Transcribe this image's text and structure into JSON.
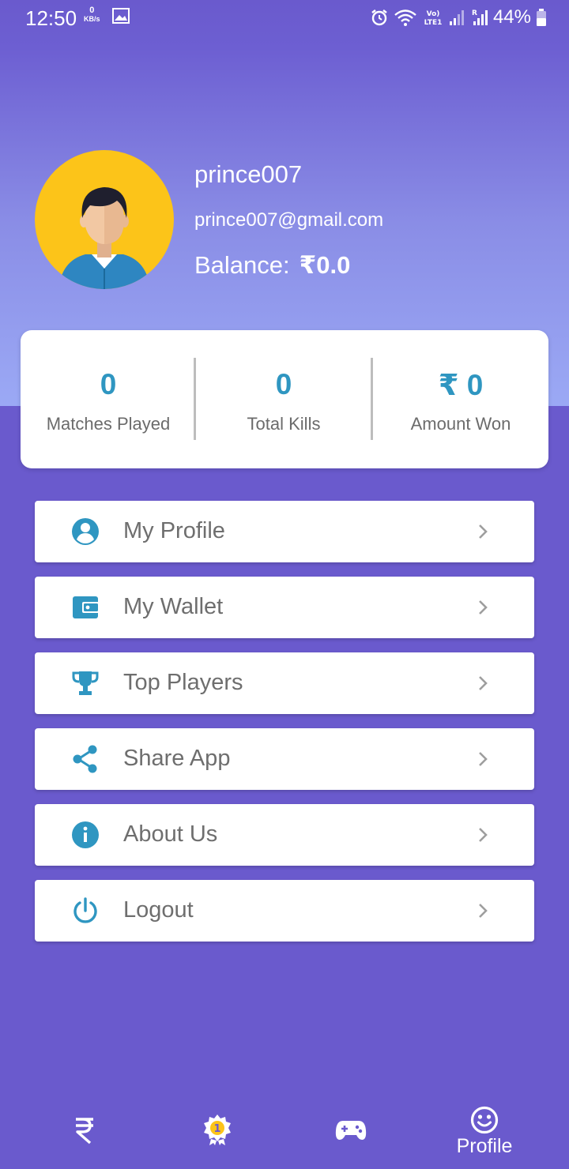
{
  "status_bar": {
    "time": "12:50",
    "net_speed_value": "0",
    "net_speed_unit": "KB/s",
    "battery_percent": "44%"
  },
  "profile": {
    "username": "prince007",
    "email": "prince007@gmail.com",
    "balance_label": "Balance:",
    "balance_value": "₹0.0"
  },
  "stats": [
    {
      "value": "0",
      "label": "Matches Played"
    },
    {
      "value": "0",
      "label": "Total Kills"
    },
    {
      "value": "₹ 0",
      "label": "Amount Won"
    }
  ],
  "menu": [
    {
      "label": "My Profile",
      "icon": "account-circle-icon"
    },
    {
      "label": "My Wallet",
      "icon": "wallet-icon"
    },
    {
      "label": "Top Players",
      "icon": "trophy-icon"
    },
    {
      "label": "Share App",
      "icon": "share-icon"
    },
    {
      "label": "About Us",
      "icon": "info-icon"
    },
    {
      "label": "Logout",
      "icon": "power-icon"
    }
  ],
  "bottom_nav": {
    "items": [
      {
        "icon": "rupee-icon",
        "label": ""
      },
      {
        "icon": "badge-number-one-icon",
        "label": ""
      },
      {
        "icon": "gamepad-icon",
        "label": ""
      },
      {
        "icon": "smiley-icon",
        "label": "Profile"
      }
    ],
    "active": "Profile"
  },
  "colors": {
    "background": "#6a5acd",
    "header_gradient_end": "#9ba9f5",
    "accent": "#2f96c1",
    "card": "#ffffff",
    "avatar_bg": "#fcc419"
  }
}
